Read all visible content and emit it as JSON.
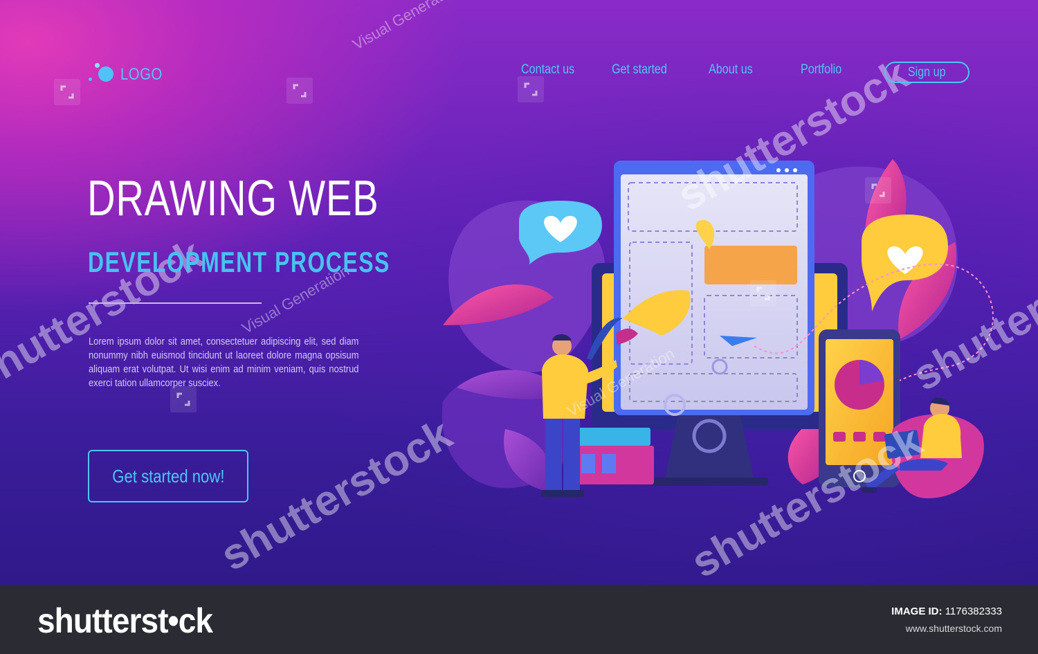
{
  "header": {
    "logo_text": "LOGO",
    "nav": [
      {
        "label": "Contact us"
      },
      {
        "label": "Get started"
      },
      {
        "label": "About us"
      },
      {
        "label": "Portfolio"
      }
    ],
    "signup_label": "Sign up"
  },
  "hero": {
    "title": "DRAWING WEB",
    "subtitle": "DEVELOPMENT PROCESS",
    "body": "Lorem ipsum dolor sit amet, consectetuer adipiscing elit, sed diam nonummy nibh euismod tincidunt ut laoreet dolore magna opsisum aliquam erat volutpat. Ut wisi enim ad minim veniam, quis nostrud exerci tation ullamcorper susciex.",
    "cta_label": "Get started now!"
  },
  "watermark": {
    "text": "shutterstock",
    "small_text": "Visual Generation"
  },
  "footer": {
    "brand": "shutterst•ck",
    "image_id_label": "IMAGE ID:",
    "image_id": "1176382333",
    "url": "www.shutterstock.com"
  },
  "colors": {
    "accent": "#4ec6f4",
    "gradient_top": "#e23ab8",
    "gradient_bottom": "#30198a",
    "footer_bg": "#2b2b33"
  }
}
